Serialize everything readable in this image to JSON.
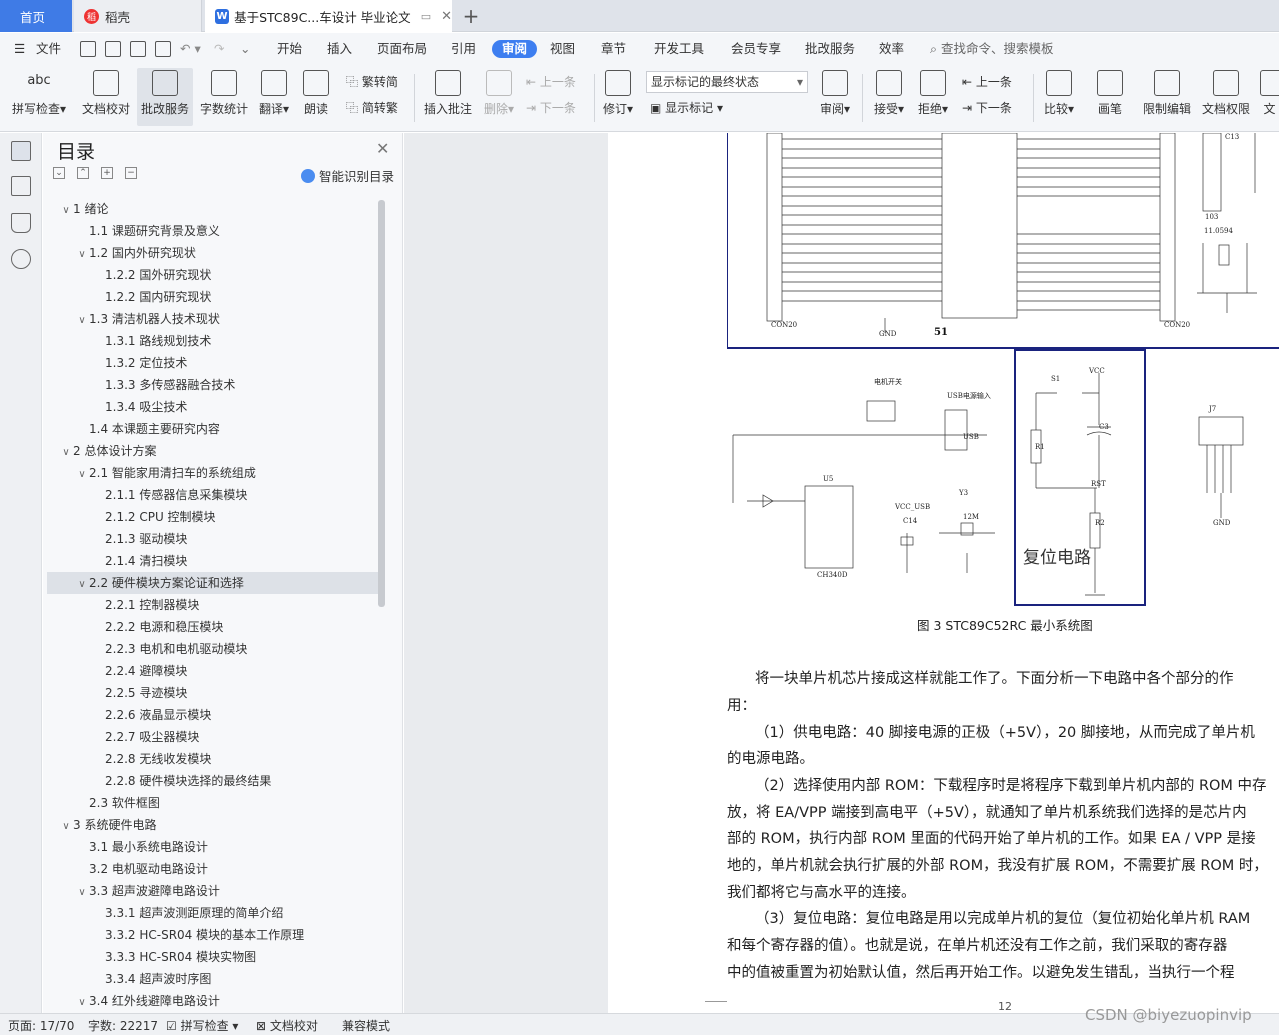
{
  "tabs": {
    "home": "首页",
    "daoke": "稻壳",
    "doc": "基于STC89C...车设计 毕业论文",
    "daoke_icon": "daoke-logo-icon",
    "doc_icon": "wps-writer-icon"
  },
  "menu": {
    "file": "文件",
    "items": [
      "开始",
      "插入",
      "页面布局",
      "引用",
      "审阅",
      "视图",
      "章节",
      "开发工具",
      "会员专享",
      "批改服务",
      "效率"
    ],
    "active": "审阅",
    "search": "查找命令、搜索模板"
  },
  "ribbon": {
    "spell": "拼写检查",
    "doc_check": "文档校对",
    "correct": "批改服务",
    "word_count": "字数统计",
    "translate": "翻译",
    "read": "朗读",
    "trad": "繁转简",
    "simp": "简转繁",
    "insert_comment": "插入批注",
    "delete": "删除",
    "prev_comment": "上一条",
    "next_comment": "下一条",
    "revise": "修订",
    "markup_select": "显示标记的最终状态",
    "show_markup": "显示标记",
    "review": "审阅",
    "accept": "接受",
    "reject": "拒绝",
    "prev": "上一条",
    "next": "下一条",
    "compare": "比较",
    "pen": "画笔",
    "restrict": "限制编辑",
    "doc_perm": "文档权限",
    "more": "文"
  },
  "toc": {
    "title": "目录",
    "smart": "智能识别目录",
    "items": [
      {
        "label": "1  绪论",
        "level": 0,
        "arrow": "v"
      },
      {
        "label": "1.1  课题研究背景及意义",
        "level": 1
      },
      {
        "label": "1.2  国内外研究现状",
        "level": 1,
        "arrow": "v"
      },
      {
        "label": "1.2.2  国外研究现状",
        "level": 2
      },
      {
        "label": "1.2.2  国内研究现状",
        "level": 2
      },
      {
        "label": "1.3  清洁机器人技术现状",
        "level": 1,
        "arrow": "v"
      },
      {
        "label": "1.3.1  路线规划技术",
        "level": 2
      },
      {
        "label": "1.3.2  定位技术",
        "level": 2
      },
      {
        "label": "1.3.3  多传感器融合技术",
        "level": 2
      },
      {
        "label": "1.3.4  吸尘技术",
        "level": 2
      },
      {
        "label": "1.4  本课题主要研究内容",
        "level": 1
      },
      {
        "label": "2  总体设计方案",
        "level": 0,
        "arrow": "v"
      },
      {
        "label": "2.1  智能家用清扫车的系统组成",
        "level": 1,
        "arrow": "v"
      },
      {
        "label": "2.1.1  传感器信息采集模块",
        "level": 2
      },
      {
        "label": "2.1.2 CPU 控制模块",
        "level": 2
      },
      {
        "label": "2.1.3  驱动模块",
        "level": 2
      },
      {
        "label": "2.1.4  清扫模块",
        "level": 2
      },
      {
        "label": "2.2  硬件模块方案论证和选择",
        "level": 1,
        "arrow": "v",
        "selected": true
      },
      {
        "label": "2.2.1  控制器模块",
        "level": 2
      },
      {
        "label": "2.2.2  电源和稳压模块",
        "level": 2
      },
      {
        "label": "2.2.3  电机和电机驱动模块",
        "level": 2
      },
      {
        "label": "2.2.4  避障模块",
        "level": 2
      },
      {
        "label": "2.2.5  寻迹模块",
        "level": 2
      },
      {
        "label": "2.2.6  液晶显示模块",
        "level": 2
      },
      {
        "label": "2.2.7  吸尘器模块",
        "level": 2
      },
      {
        "label": "2.2.8  无线收发模块",
        "level": 2
      },
      {
        "label": "2.2.8  硬件模块选择的最终结果",
        "level": 2
      },
      {
        "label": "2.3  软件框图",
        "level": 1
      },
      {
        "label": "3  系统硬件电路",
        "level": 0,
        "arrow": "v"
      },
      {
        "label": "3.1  最小系统电路设计",
        "level": 1
      },
      {
        "label": "3.2  电机驱动电路设计",
        "level": 1
      },
      {
        "label": "3.3  超声波避障电路设计",
        "level": 1,
        "arrow": "v"
      },
      {
        "label": "3.3.1  超声波测距原理的简单介绍",
        "level": 2
      },
      {
        "label": "3.3.2 HC-SR04 模块的基本工作原理",
        "level": 2
      },
      {
        "label": "3.3.3 HC-SR04 模块实物图",
        "level": 2
      },
      {
        "label": "3.3.4  超声波时序图",
        "level": 2
      },
      {
        "label": "3.4  红外线避障电路设计",
        "level": 1,
        "arrow": "v"
      }
    ]
  },
  "figure": {
    "caption": "图 3  STC89C52RC 最小系统图",
    "chip": "51",
    "reset_label": "复位电路",
    "u5": "CH340D",
    "crystal": "11.0594",
    "crystal2": "12M",
    "con": "CON20",
    "vcc": "VCC",
    "gnd": "GND"
  },
  "body": {
    "p1a": "将一块单片机芯片接成这样就能工作了。下面分析一下电路中各个部分的作",
    "p1b": "用：",
    "p2a": "（1）供电电路：40 脚接电源的正极（+5V），20 脚接地，从而完成了单片机",
    "p2b": "的电源电路。",
    "p3a": "（2）选择使用内部 ROM：下载程序时是将程序下载到单片机内部的 ROM 中存",
    "p3b": "放，将 EA/VPP 端接到高电平（+5V），就通知了单片机系统我们选择的是芯片内",
    "p3c": "部的 ROM，执行内部 ROM 里面的代码开始了单片机的工作。如果 EA / VPP 是接",
    "p3d": "地的，单片机就会执行扩展的外部 ROM，我没有扩展 ROM，不需要扩展 ROM 时，",
    "p3e": "我们都将它与高水平的连接。",
    "p4a": "（3）复位电路：复位电路是用以完成单片机的复位（复位初始化单片机 RAM",
    "p4b": "和每个寄存器的值）。也就是说，在单片机还没有工作之前，我们采取的寄存器",
    "p4c": "中的值被重置为初始默认值，然后再开始工作。以避免发生错乱，当执行一个程",
    "page_number": "12"
  },
  "status": {
    "page": "页面: 17/70",
    "words": "字数: 22217",
    "spell": "拼写检查",
    "check": "文档校对",
    "compat": "兼容模式"
  },
  "watermark": "CSDN @biyezuopinvip"
}
